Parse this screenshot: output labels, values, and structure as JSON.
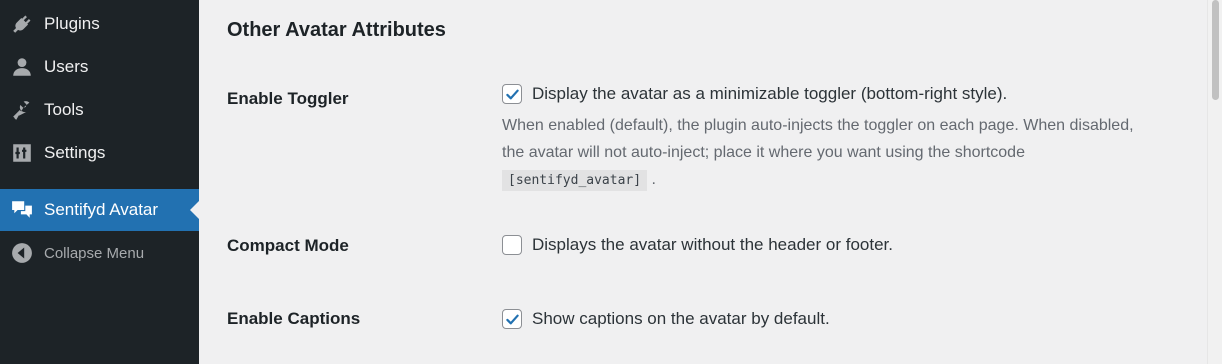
{
  "sidebar": {
    "items": [
      {
        "label": "Plugins",
        "icon": "plugin-icon"
      },
      {
        "label": "Users",
        "icon": "user-icon"
      },
      {
        "label": "Tools",
        "icon": "wrench-icon"
      },
      {
        "label": "Settings",
        "icon": "sliders-icon"
      }
    ],
    "active": {
      "label": "Sentifyd Avatar",
      "icon": "speech-bubbles-icon"
    },
    "collapse": {
      "label": "Collapse Menu",
      "icon": "collapse-arrow-icon"
    }
  },
  "section": {
    "title": "Other Avatar Attributes"
  },
  "settings": {
    "toggler": {
      "label": "Enable Toggler",
      "checked": true,
      "option_text": "Display the avatar as a minimizable toggler (bottom-right style).",
      "desc_part1": "When enabled (default), the plugin auto-injects the toggler on each page. When disabled, the avatar will not auto-inject; place it where you want using the shortcode",
      "shortcode": "[sentifyd_avatar]",
      "desc_end": "."
    },
    "compact": {
      "label": "Compact Mode",
      "checked": false,
      "option_text": "Displays the avatar without the header or footer."
    },
    "captions": {
      "label": "Enable Captions",
      "checked": true,
      "option_text": "Show captions on the avatar by default."
    }
  },
  "colors": {
    "sidebar_bg": "#1d2327",
    "active_bg": "#2271b1",
    "accent": "#2271b1",
    "page_bg": "#f0f0f1"
  }
}
